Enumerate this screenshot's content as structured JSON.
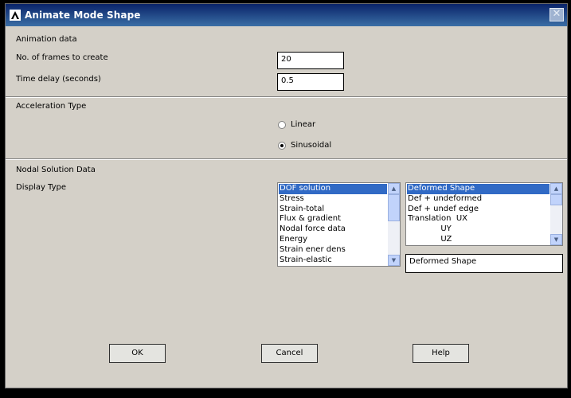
{
  "window": {
    "title": "Animate Mode Shape",
    "close_symbol": "✕",
    "icon": "ansys-logo-icon"
  },
  "animation": {
    "heading": "Animation data",
    "frames_label": "No. of frames to create",
    "frames_value": "20",
    "delay_label": "Time delay (seconds)",
    "delay_value": "0.5"
  },
  "acceleration": {
    "heading": "Acceleration Type",
    "options": [
      {
        "label": "Linear",
        "checked": false
      },
      {
        "label": "Sinusoidal",
        "checked": true
      }
    ]
  },
  "nodal": {
    "heading": "Nodal Solution Data",
    "display_type_label": "Display Type",
    "list_left": [
      "DOF solution",
      "Stress",
      "Strain-total",
      "Flux & gradient",
      "Nodal force data",
      "Energy",
      "Strain ener dens",
      "Strain-elastic"
    ],
    "list_left_selected": 0,
    "list_right": [
      "Deformed Shape",
      "Def + undeformed",
      "Def + undef edge",
      "Translation  UX",
      "             UY",
      "             UZ"
    ],
    "list_right_selected": 0,
    "selection_text": "Deformed Shape"
  },
  "buttons": {
    "ok": "OK",
    "cancel": "Cancel",
    "help": "Help"
  },
  "colors": {
    "titlebar": "#0a246a",
    "dialog_bg": "#d4d0c8",
    "selection": "#316ac5"
  }
}
